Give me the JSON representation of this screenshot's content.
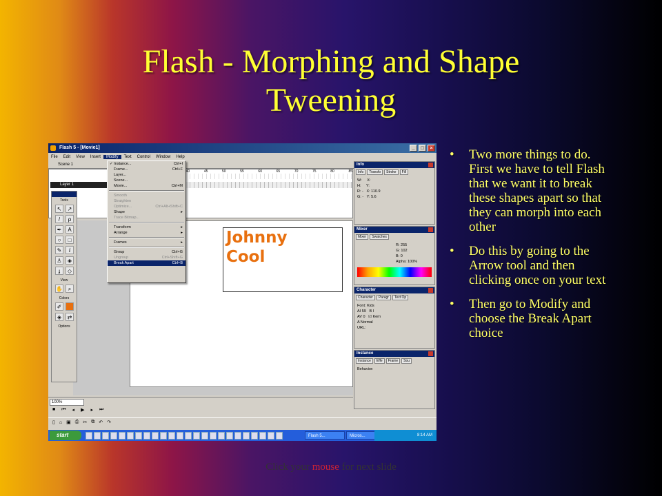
{
  "slide": {
    "title_line1": "Flash - Morphing and Shape",
    "title_line2": "Tweening",
    "bullets": [
      "Two more things to do.  First we have to tell Flash that we want it to break these shapes apart so that they can morph into each other",
      "Do this by going to the Arrow tool and then clicking once on your text",
      "Then go to Modify and choose the Break Apart choice"
    ],
    "footer_before": "Click your ",
    "footer_highlight": "mouse",
    "footer_after": " for next slide"
  },
  "app": {
    "window_title": "Flash 5 - [Movie1]",
    "menu": [
      "File",
      "Edit",
      "View",
      "Insert",
      "Modify",
      "Text",
      "Control",
      "Window",
      "Help"
    ],
    "scene_label": "Scene 1",
    "layer_name": "Layer 1",
    "timeline_numbers": [
      "25",
      "30",
      "35",
      "40",
      "45",
      "50",
      "55",
      "60",
      "65",
      "70",
      "75",
      "80",
      "85"
    ],
    "modify_menu": [
      {
        "label": "Instance...",
        "shortcut": "Ctrl+I",
        "state": "checked"
      },
      {
        "label": "Frame...",
        "shortcut": "Ctrl+F",
        "state": "normal"
      },
      {
        "label": "Layer...",
        "shortcut": "",
        "state": "normal"
      },
      {
        "label": "Scene...",
        "shortcut": "",
        "state": "normal"
      },
      {
        "label": "Movie...",
        "shortcut": "Ctrl+M",
        "state": "normal"
      },
      {
        "sep": true
      },
      {
        "label": "Smooth",
        "shortcut": "",
        "state": "dim"
      },
      {
        "label": "Straighten",
        "shortcut": "",
        "state": "dim"
      },
      {
        "label": "Optimize...",
        "shortcut": "Ctrl+Alt+Shift+C",
        "state": "dim"
      },
      {
        "label": "Shape",
        "shortcut": "▸",
        "state": "normal"
      },
      {
        "label": "Trace Bitmap...",
        "shortcut": "",
        "state": "dim"
      },
      {
        "sep": true
      },
      {
        "label": "Transform",
        "shortcut": "▸",
        "state": "normal"
      },
      {
        "label": "Arrange",
        "shortcut": "▸",
        "state": "normal"
      },
      {
        "sep": true
      },
      {
        "label": "Frames",
        "shortcut": "▸",
        "state": "normal"
      },
      {
        "sep": true
      },
      {
        "label": "Group",
        "shortcut": "Ctrl+G",
        "state": "normal"
      },
      {
        "label": "Ungroup",
        "shortcut": "Ctrl+Shift+G",
        "state": "dim"
      },
      {
        "label": "Break Apart",
        "shortcut": "Ctrl+B",
        "state": "selected"
      }
    ],
    "toolbox": {
      "title": "Tools",
      "view_label": "View",
      "colors_label": "Colors",
      "options_label": "Options"
    },
    "canvas_text_line1": "Johnny",
    "canvas_text_line2": "Cool",
    "zoom_value": "100%",
    "panels": {
      "info": {
        "title": "Info",
        "tabs": [
          "Info",
          "Transfo",
          "Stroke",
          "Fill"
        ],
        "x_value": "110.9",
        "y_value": "5.6"
      },
      "mixer": {
        "title": "Mixer",
        "tabs": [
          "Mixer",
          "Swatches"
        ],
        "r": "255",
        "g": "102",
        "b": "0",
        "alpha": "100%"
      },
      "character": {
        "title": "Character",
        "tabs": [
          "Character",
          "Paragr",
          "Text Op"
        ],
        "font": "Kids",
        "size": "59",
        "tracking": "0",
        "kern_label": "Kern",
        "baseline": "Normal",
        "url_label": "URL:"
      },
      "instance": {
        "title": "Instance",
        "tabs": [
          "Instance",
          "Effe",
          "Frame",
          "Sou"
        ],
        "behavior_label": "Behavior:"
      }
    },
    "taskbar": {
      "start_label": "start",
      "tasks": [
        "Flash 5...",
        "Micros..."
      ],
      "clock": "8:14 AM"
    }
  },
  "colors": {
    "title": "#ffff33",
    "bullets": "#ffff66",
    "canvas_text": "#e8700f",
    "footer_highlight": "#cc2233"
  }
}
